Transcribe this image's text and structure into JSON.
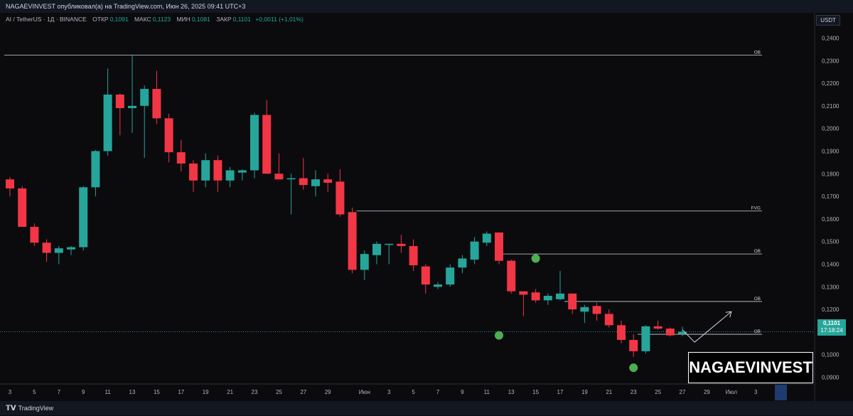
{
  "header": {
    "publisher_line": "NAGAEVINVEST опубликовал(а) на TradingView.com, Июн 26, 2025 09:41 UTC+3"
  },
  "symbol": {
    "name": "AI / TetherUS · 1Д · BINANCE",
    "open_label": "ОТКР",
    "open": "0,1091",
    "high_label": "МАКС",
    "high": "0,1123",
    "low_label": "МИН",
    "low": "0,1081",
    "close_label": "ЗАКР",
    "close": "0,1101",
    "change": "+0,0011 (+1,01%)"
  },
  "currency": "USDT",
  "last_price": {
    "value": "0,1101",
    "countdown": "17:18:24"
  },
  "brand": "NAGAEVINVEST",
  "footer": {
    "logo_text": "TradingView"
  },
  "colors": {
    "up": "#26a69a",
    "down": "#f23645",
    "background": "#0b0b0e",
    "accent": "#26a69a",
    "marker": "#4caf50"
  },
  "chart_data": {
    "type": "candlestick",
    "ylim": [
      0.087,
      0.2455
    ],
    "y_ticks": [
      {
        "v": 0.24,
        "label": "0,2400"
      },
      {
        "v": 0.23,
        "label": "0,2300"
      },
      {
        "v": 0.22,
        "label": "0,2200"
      },
      {
        "v": 0.21,
        "label": "0,2100"
      },
      {
        "v": 0.2,
        "label": "0,2000"
      },
      {
        "v": 0.19,
        "label": "0,1900"
      },
      {
        "v": 0.18,
        "label": "0,1800"
      },
      {
        "v": 0.17,
        "label": "0,1700"
      },
      {
        "v": 0.16,
        "label": "0,1600"
      },
      {
        "v": 0.15,
        "label": "0,1500"
      },
      {
        "v": 0.14,
        "label": "0,1400"
      },
      {
        "v": 0.13,
        "label": "0,1300"
      },
      {
        "v": 0.12,
        "label": "0,1200"
      },
      {
        "v": 0.1,
        "label": "0,1000"
      },
      {
        "v": 0.09,
        "label": "0,0900"
      }
    ],
    "x_ticks": [
      {
        "i": 0,
        "label": "3"
      },
      {
        "i": 2,
        "label": "5"
      },
      {
        "i": 4,
        "label": "7"
      },
      {
        "i": 6,
        "label": "9"
      },
      {
        "i": 8,
        "label": "11"
      },
      {
        "i": 10,
        "label": "13"
      },
      {
        "i": 12,
        "label": "15"
      },
      {
        "i": 14,
        "label": "17"
      },
      {
        "i": 16,
        "label": "19"
      },
      {
        "i": 18,
        "label": "21"
      },
      {
        "i": 20,
        "label": "23"
      },
      {
        "i": 22,
        "label": "25"
      },
      {
        "i": 24,
        "label": "27"
      },
      {
        "i": 26,
        "label": "29"
      },
      {
        "i": 29,
        "label": "Июн"
      },
      {
        "i": 31,
        "label": "3"
      },
      {
        "i": 33,
        "label": "5"
      },
      {
        "i": 35,
        "label": "7"
      },
      {
        "i": 37,
        "label": "9"
      },
      {
        "i": 39,
        "label": "11"
      },
      {
        "i": 41,
        "label": "13"
      },
      {
        "i": 43,
        "label": "15"
      },
      {
        "i": 45,
        "label": "17"
      },
      {
        "i": 47,
        "label": "19"
      },
      {
        "i": 49,
        "label": "21"
      },
      {
        "i": 51,
        "label": "23"
      },
      {
        "i": 53,
        "label": "25"
      },
      {
        "i": 55,
        "label": "27"
      },
      {
        "i": 57,
        "label": "29"
      },
      {
        "i": 59,
        "label": "Июл"
      },
      {
        "i": 61,
        "label": "3"
      },
      {
        "i": 63,
        "label": "5"
      }
    ],
    "candles": [
      [
        0.1775,
        0.1785,
        0.17,
        0.1735
      ],
      [
        0.1735,
        0.1745,
        0.161,
        0.1565
      ],
      [
        0.1565,
        0.158,
        0.148,
        0.1495
      ],
      [
        0.1495,
        0.151,
        0.141,
        0.145
      ],
      [
        0.145,
        0.148,
        0.14,
        0.147
      ],
      [
        0.1465,
        0.148,
        0.144,
        0.1475
      ],
      [
        0.1475,
        0.1745,
        0.146,
        0.174
      ],
      [
        0.174,
        0.1905,
        0.17,
        0.19
      ],
      [
        0.19,
        0.2265,
        0.188,
        0.215
      ],
      [
        0.215,
        0.2155,
        0.197,
        0.209
      ],
      [
        0.209,
        0.2325,
        0.198,
        0.21
      ],
      [
        0.21,
        0.219,
        0.187,
        0.2175
      ],
      [
        0.2175,
        0.2255,
        0.202,
        0.2045
      ],
      [
        0.2045,
        0.2065,
        0.185,
        0.1895
      ],
      [
        0.1895,
        0.195,
        0.181,
        0.1845
      ],
      [
        0.1845,
        0.186,
        0.172,
        0.177
      ],
      [
        0.177,
        0.189,
        0.174,
        0.186
      ],
      [
        0.186,
        0.188,
        0.172,
        0.177
      ],
      [
        0.177,
        0.183,
        0.174,
        0.1815
      ],
      [
        0.1805,
        0.182,
        0.177,
        0.1815
      ],
      [
        0.1815,
        0.207,
        0.178,
        0.206
      ],
      [
        0.206,
        0.2125,
        0.18,
        0.18
      ],
      [
        0.18,
        0.189,
        0.178,
        0.1775
      ],
      [
        0.1775,
        0.18,
        0.162,
        0.178
      ],
      [
        0.178,
        0.187,
        0.173,
        0.175
      ],
      [
        0.1745,
        0.1815,
        0.17,
        0.1775
      ],
      [
        0.1775,
        0.18,
        0.172,
        0.176
      ],
      [
        0.1765,
        0.182,
        0.161,
        0.162
      ],
      [
        0.163,
        0.165,
        0.136,
        0.1375
      ],
      [
        0.1375,
        0.146,
        0.133,
        0.1445
      ],
      [
        0.144,
        0.15,
        0.14,
        0.149
      ],
      [
        0.149,
        0.149,
        0.14,
        0.149
      ],
      [
        0.149,
        0.153,
        0.145,
        0.148
      ],
      [
        0.148,
        0.151,
        0.137,
        0.1395
      ],
      [
        0.139,
        0.14,
        0.127,
        0.131
      ],
      [
        0.13,
        0.132,
        0.129,
        0.131
      ],
      [
        0.131,
        0.14,
        0.13,
        0.1385
      ],
      [
        0.1385,
        0.144,
        0.136,
        0.1425
      ],
      [
        0.142,
        0.152,
        0.14,
        0.15
      ],
      [
        0.1495,
        0.1545,
        0.148,
        0.1535
      ],
      [
        0.154,
        0.154,
        0.14,
        0.1415
      ],
      [
        0.1415,
        0.142,
        0.127,
        0.128
      ],
      [
        0.128,
        0.128,
        0.117,
        0.1265
      ],
      [
        0.1275,
        0.129,
        0.123,
        0.124
      ],
      [
        0.124,
        0.127,
        0.122,
        0.126
      ],
      [
        0.1245,
        0.137,
        0.124,
        0.127
      ],
      [
        0.127,
        0.127,
        0.118,
        0.12
      ],
      [
        0.119,
        0.122,
        0.114,
        0.121
      ],
      [
        0.1215,
        0.123,
        0.115,
        0.118
      ],
      [
        0.118,
        0.12,
        0.112,
        0.113
      ],
      [
        0.113,
        0.115,
        0.105,
        0.1065
      ],
      [
        0.1065,
        0.109,
        0.099,
        0.1015
      ],
      [
        0.1015,
        0.113,
        0.1005,
        0.1125
      ],
      [
        0.1125,
        0.115,
        0.111,
        0.1115
      ],
      [
        0.1115,
        0.112,
        0.108,
        0.1085
      ],
      [
        0.1091,
        0.1123,
        0.1081,
        0.1101
      ]
    ],
    "levels": [
      {
        "label": "OB",
        "value": 0.2325,
        "from": 0
      },
      {
        "label": "FVG",
        "value": 0.1635,
        "from": 28
      },
      {
        "label": "OB",
        "value": 0.1445,
        "from": 40
      },
      {
        "label": "OB",
        "value": 0.1235,
        "from": 45
      },
      {
        "label": "OB",
        "value": 0.109,
        "from": 51
      }
    ],
    "markers": [
      {
        "i": 43,
        "v": 0.1425
      },
      {
        "i": 40,
        "v": 0.1085
      },
      {
        "i": 51,
        "v": 0.0942
      }
    ],
    "projection": [
      {
        "i": 55,
        "v": 0.111
      },
      {
        "i": 56,
        "v": 0.1055
      },
      {
        "i": 59,
        "v": 0.119
      }
    ]
  }
}
